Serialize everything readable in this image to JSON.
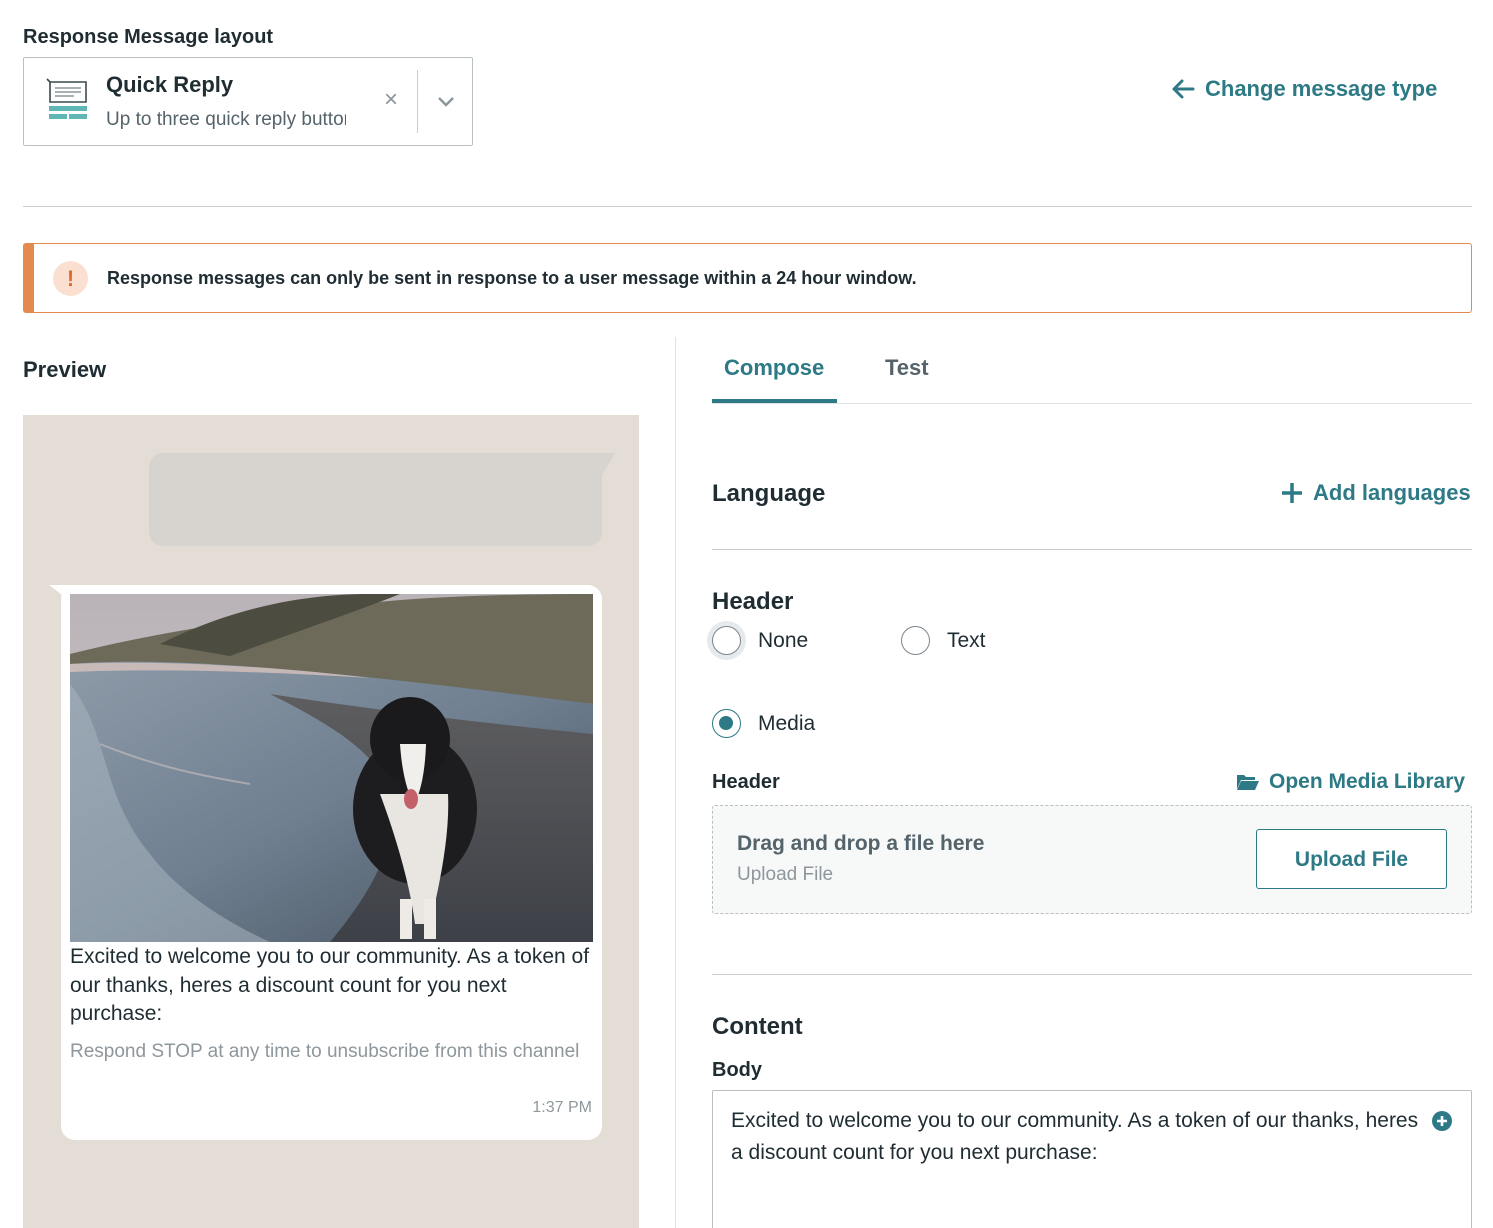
{
  "layout": {
    "label": "Response Message layout",
    "selected_title": "Quick Reply",
    "selected_subtitle": "Up to three quick reply buttons"
  },
  "change_type": {
    "label": "Change message type",
    "icon": "arrow-left-icon"
  },
  "alert": {
    "icon_text": "!",
    "text": "Response messages can only be sent in response to a user message within a 24 hour window."
  },
  "preview": {
    "label": "Preview",
    "message_body": "Excited to welcome you to our community. As a token of our thanks, heres a discount count for you next purchase:",
    "footer": "Respond STOP at any time to unsubscribe from this channel",
    "time": "1:37 PM"
  },
  "tabs": [
    {
      "label": "Compose",
      "active": true
    },
    {
      "label": "Test",
      "active": false
    }
  ],
  "language": {
    "title": "Language",
    "add_label": "Add languages"
  },
  "header": {
    "title": "Header",
    "options": [
      {
        "label": "None",
        "checked": false
      },
      {
        "label": "Text",
        "checked": false
      },
      {
        "label": "Media",
        "checked": true
      }
    ],
    "media_label": "Header",
    "media_library": "Open Media Library",
    "dropzone_title": "Drag and drop a file here",
    "dropzone_sub": "Upload File",
    "upload_button": "Upload File"
  },
  "content": {
    "title": "Content",
    "body_label": "Body",
    "body_value": "Excited to welcome you to our community. As a token of our thanks, heres a discount count for you next purchase:"
  },
  "colors": {
    "accent": "#2d7a86",
    "warning": "#e58a4e",
    "chat_background": "#e4ddd6"
  }
}
